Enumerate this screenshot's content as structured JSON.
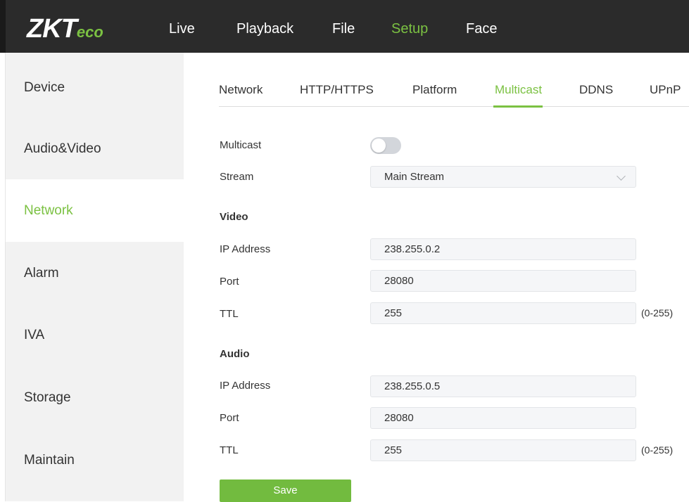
{
  "brand": {
    "logo_main": "ZKT",
    "logo_sub": "eco",
    "accent_color": "#7bc142"
  },
  "topnav": {
    "items": [
      "Live",
      "Playback",
      "File",
      "Setup",
      "Face"
    ],
    "active": "Setup"
  },
  "sidebar": {
    "items": [
      "Device",
      "Audio&Video",
      "Network",
      "Alarm",
      "IVA",
      "Storage",
      "Maintain"
    ],
    "active": "Network"
  },
  "tabs": {
    "items": [
      "Network",
      "HTTP/HTTPS",
      "Platform",
      "Multicast",
      "DDNS",
      "UPnP"
    ],
    "active": "Multicast"
  },
  "form": {
    "multicast_label": "Multicast",
    "multicast_enabled": false,
    "stream_label": "Stream",
    "stream_value": "Main Stream",
    "video": {
      "title": "Video",
      "ip_label": "IP Address",
      "ip_value": "238.255.0.2",
      "port_label": "Port",
      "port_value": "28080",
      "ttl_label": "TTL",
      "ttl_value": "255",
      "ttl_range": "(0-255)"
    },
    "audio": {
      "title": "Audio",
      "ip_label": "IP Address",
      "ip_value": "238.255.0.5",
      "port_label": "Port",
      "port_value": "28080",
      "ttl_label": "TTL",
      "ttl_value": "255",
      "ttl_range": "(0-255)"
    },
    "save_label": "Save"
  }
}
